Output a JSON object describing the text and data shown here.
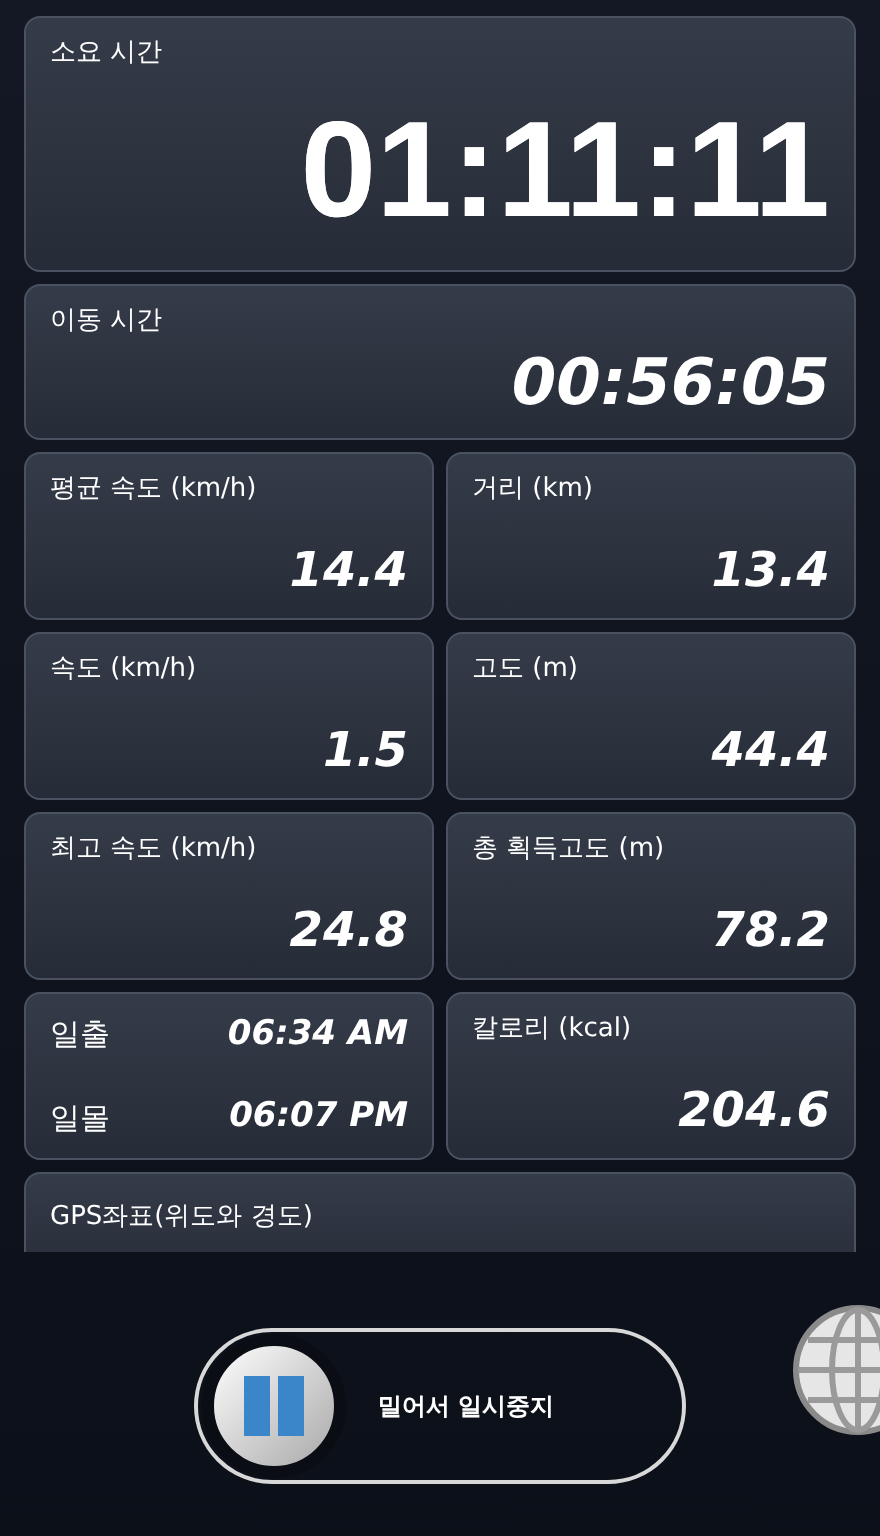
{
  "total_time": {
    "label": "소요 시간",
    "value": "01:11:11"
  },
  "moving_time": {
    "label": "이동 시간",
    "value": "00:56:05"
  },
  "grid": [
    {
      "kind": "stat",
      "label": "평균 속도 (km/h)",
      "value": "14.4"
    },
    {
      "kind": "stat",
      "label": "거리 (km)",
      "value": "13.4"
    },
    {
      "kind": "stat",
      "label": "속도 (km/h)",
      "value": "1.5"
    },
    {
      "kind": "stat",
      "label": "고도 (m)",
      "value": "44.4"
    },
    {
      "kind": "stat",
      "label": "최고 속도 (km/h)",
      "value": "24.8"
    },
    {
      "kind": "stat",
      "label": "총 획득고도 (m)",
      "value": "78.2"
    },
    {
      "kind": "sun_times",
      "rows": [
        {
          "label": "일출",
          "value": "06:34 AM"
        },
        {
          "label": "일몰",
          "value": "06:07 PM"
        }
      ]
    },
    {
      "kind": "stat",
      "label": "칼로리 (kcal)",
      "value": "204.6"
    }
  ],
  "gps": {
    "label": "GPS좌표(위도와 경도)"
  },
  "slider": {
    "label": "밀어서 일시중지",
    "level": 0
  }
}
